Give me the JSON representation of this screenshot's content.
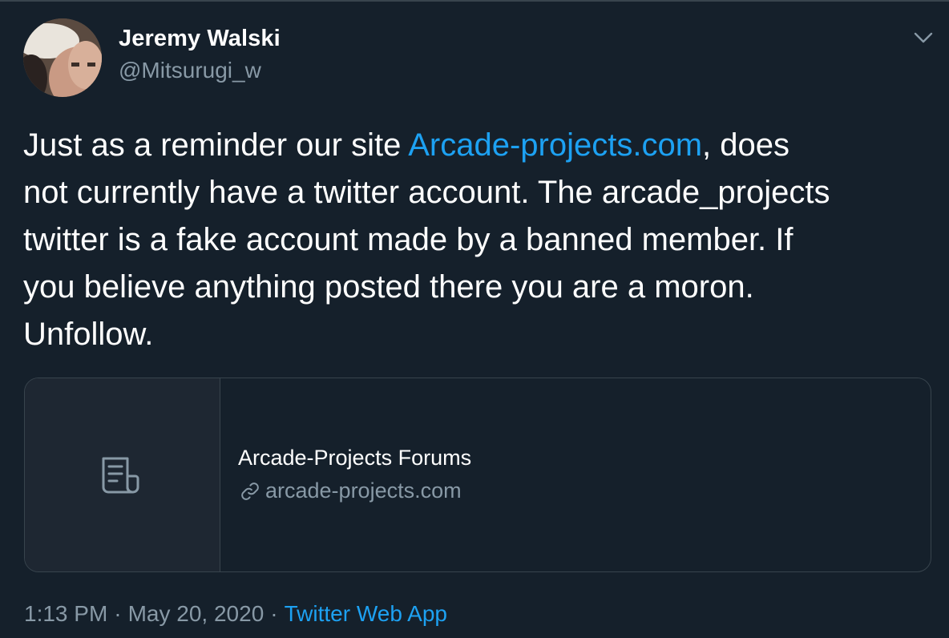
{
  "user": {
    "display_name": "Jeremy Walski",
    "handle": "@Mitsurugi_w"
  },
  "tweet": {
    "text_before_link": "Just as a reminder our site ",
    "link_text": "Arcade-projects.com",
    "text_after_link_line1": ", does",
    "line2": "not currently have a twitter account.  The arcade_projects",
    "line3": "twitter is a fake account made by a banned member.  If",
    "line4": "you believe anything posted there you are a moron.",
    "line5": "Unfollow."
  },
  "card": {
    "title": "Arcade-Projects Forums",
    "domain": "arcade-projects.com"
  },
  "meta": {
    "time": "1:13 PM",
    "separator": "·",
    "date": "May 20, 2020",
    "source": "Twitter Web App"
  },
  "colors": {
    "background": "#15202b",
    "border": "#38444d",
    "secondary_text": "#8899a6",
    "accent": "#1da1f2"
  },
  "icons": {
    "caret": "chevron-down-icon",
    "card_placeholder": "document-icon",
    "domain": "link-icon"
  }
}
